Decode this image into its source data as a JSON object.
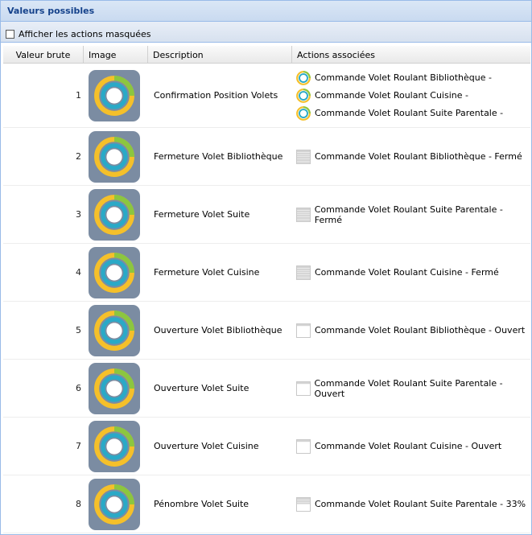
{
  "panel": {
    "title": "Valeurs possibles"
  },
  "toolbar": {
    "show_hidden_label": "Afficher les actions masquées"
  },
  "columns": [
    "Valeur brute",
    "Image",
    "Description",
    "Actions associées"
  ],
  "rows": [
    {
      "value": "1",
      "description": "Confirmation Position Volets",
      "icon": "ring-app-icon",
      "actions": [
        {
          "icon": "ring-small-icon",
          "label": "Commande Volet Roulant Bibliothèque -"
        },
        {
          "icon": "ring-small-icon",
          "label": "Commande Volet Roulant Cuisine -"
        },
        {
          "icon": "ring-small-icon",
          "label": "Commande Volet Roulant Suite Parentale -"
        }
      ]
    },
    {
      "value": "2",
      "description": "Fermeture Volet Bibliothèque",
      "icon": "ring-app-icon",
      "actions": [
        {
          "icon": "shutter-closed-icon",
          "label": "Commande Volet Roulant Bibliothèque - Fermé"
        }
      ]
    },
    {
      "value": "3",
      "description": "Fermeture Volet Suite",
      "icon": "ring-app-icon",
      "actions": [
        {
          "icon": "shutter-closed-icon",
          "label": "Commande Volet Roulant Suite Parentale - Fermé"
        }
      ]
    },
    {
      "value": "4",
      "description": "Fermeture Volet Cuisine",
      "icon": "ring-app-icon",
      "actions": [
        {
          "icon": "shutter-closed-icon",
          "label": "Commande Volet Roulant Cuisine - Fermé"
        }
      ]
    },
    {
      "value": "5",
      "description": "Ouverture Volet Bibliothèque",
      "icon": "ring-app-icon",
      "actions": [
        {
          "icon": "shutter-open-icon",
          "label": "Commande Volet Roulant Bibliothèque - Ouvert"
        }
      ]
    },
    {
      "value": "6",
      "description": "Ouverture Volet Suite",
      "icon": "ring-app-icon",
      "actions": [
        {
          "icon": "shutter-open-icon",
          "label": "Commande Volet Roulant Suite Parentale - Ouvert"
        }
      ]
    },
    {
      "value": "7",
      "description": "Ouverture Volet Cuisine",
      "icon": "ring-app-icon",
      "actions": [
        {
          "icon": "shutter-open-icon",
          "label": "Commande Volet Roulant Cuisine - Ouvert"
        }
      ]
    },
    {
      "value": "8",
      "description": "Pénombre Volet Suite",
      "icon": "ring-app-icon",
      "actions": [
        {
          "icon": "shutter-partial-icon",
          "label": "Commande Volet Roulant Suite Parentale - 33%"
        }
      ]
    }
  ],
  "colors": {
    "accent": "#15428b",
    "ring_yellow": "#f5c02a",
    "ring_teal": "#2aa9c7",
    "ring_green": "#8cc63f",
    "tile_bg": "#7b8ca2"
  }
}
